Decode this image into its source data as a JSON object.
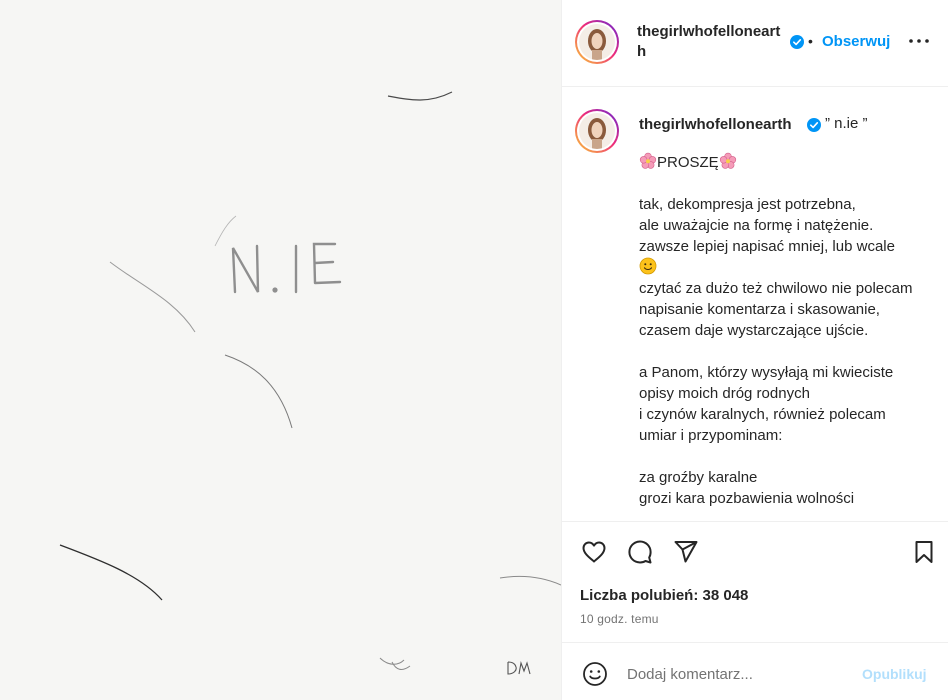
{
  "image": {
    "handwritten_text": "N.IE",
    "signature": "DM"
  },
  "header": {
    "username": "thegirlwhofellonearth",
    "separator": "•",
    "follow_label": "Obserwuj",
    "icons": [
      "verified-badge-icon",
      "more-options-icon"
    ]
  },
  "caption": {
    "username": "thegirlwhofellonearth",
    "title": "” n.ie ”",
    "heading": "PROSZĘ",
    "paragraph1": "tak, dekompresja jest potrzebna,\nale uważajcie na formę i natężenie.\nzawsze lepiej napisać mniej, lub wcale",
    "paragraph2": "czytać za dużo też chwilowo nie polecam\nnapisanie komentarza i skasowanie,\nczasem daje wystarczające ujście.",
    "paragraph3": "a Panom, którzy wysyłają mi kwieciste\nopisy moich dróg rodnych\ni czynów karalnych, również polecam\numiar i przypominam:",
    "paragraph4": "za groźby karalne\ngrozi kara pozbawienia wolności",
    "emojis": [
      "cherry-blossom",
      "slightly-smiling-face"
    ]
  },
  "actions": {
    "icons": [
      "heart-icon",
      "comment-icon",
      "share-icon",
      "bookmark-icon"
    ],
    "likes_text": "Liczba polubień: 38 048",
    "time_text": "10 godz. temu"
  },
  "comment_box": {
    "placeholder": "Dodaj komentarz...",
    "post_label": "Opublikuj",
    "icon": "emoji-icon"
  },
  "colors": {
    "accent": "#0095f6",
    "post_disabled": "#b2dffc",
    "muted": "#737373",
    "image_bg": "#f6f6f4"
  }
}
